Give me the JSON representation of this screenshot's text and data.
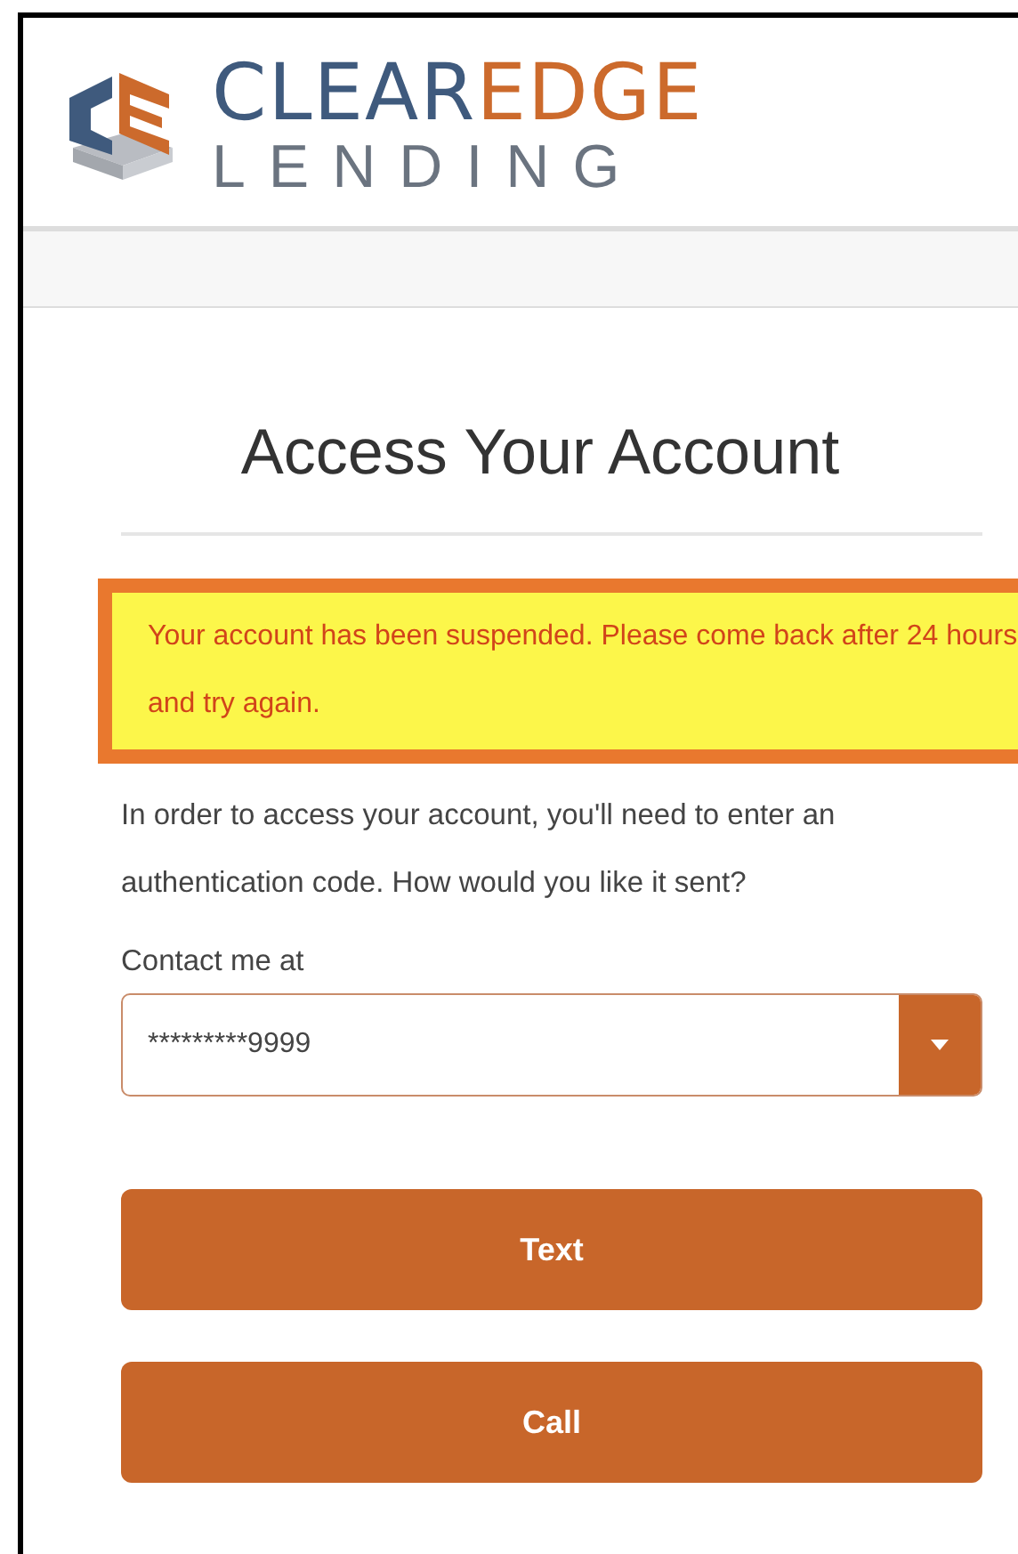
{
  "logo": {
    "wordmark": [
      {
        "text": "CLEAR",
        "color": "#3f5a7d"
      },
      {
        "text": "EDGE",
        "color": "#cc6a2c"
      }
    ],
    "subtitle": "LENDING"
  },
  "title": "Access Your Account",
  "alert": {
    "message": "Your account has been suspended. Please come back after 24 hours and try again."
  },
  "instructions": "In order to access your account, you'll need to enter an authentication code. How would you like it sent?",
  "contact": {
    "label": "Contact me at",
    "value": "*********9999"
  },
  "buttons": [
    "Text",
    "Call"
  ]
}
